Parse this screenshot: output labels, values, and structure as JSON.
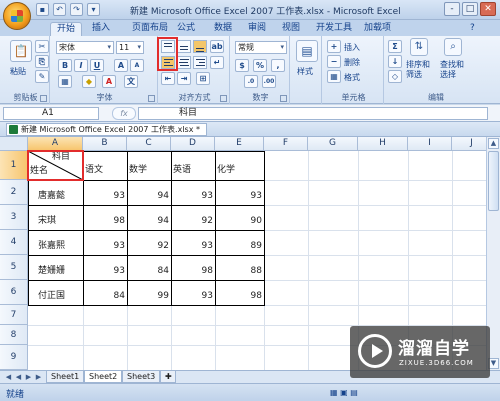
{
  "window": {
    "title": "新建 Microsoft Office Excel 2007 工作表.xlsx - Microsoft Excel",
    "qat_icons": [
      "save-icon",
      "undo-icon",
      "redo-icon",
      "customize-icon"
    ],
    "controls": [
      "-",
      "□",
      "✕"
    ]
  },
  "ribbon_tabs": [
    "开始",
    "插入",
    "页面布局",
    "公式",
    "数据",
    "审阅",
    "视图",
    "开发工具",
    "加载项"
  ],
  "active_tab": "开始",
  "clipboard": {
    "paste_label": "粘贴",
    "group_label": "剪贴板"
  },
  "font_group": {
    "font_name": "宋体",
    "font_size": "11",
    "bold": "B",
    "italic": "I",
    "underline": "U",
    "grow": "A",
    "shrink": "A",
    "wen": "文",
    "group_label": "字体"
  },
  "alignment": {
    "group_label": "对齐方式",
    "highlight_color": "#e22c2c"
  },
  "number": {
    "format": "常规",
    "currency": "$",
    "percent": "%",
    "comma": ",",
    "group_label": "数字"
  },
  "styles": {
    "label": "样式"
  },
  "cells": {
    "insert": "插入",
    "delete": "删除",
    "format": "格式",
    "group_label": "单元格"
  },
  "editing": {
    "sum": "Σ",
    "sort_filter": "排序和\n筛选",
    "find_select": "查找和\n选择",
    "group_label": "编辑"
  },
  "formula_bar": {
    "name_box": "A1",
    "fx": "fx",
    "content": "科目"
  },
  "workbook_tab": "新建 Microsoft Office Excel 2007 工作表.xlsx *",
  "columns": [
    "A",
    "B",
    "C",
    "D",
    "E",
    "F",
    "G",
    "H",
    "I",
    "J"
  ],
  "rows": [
    "1",
    "2",
    "3",
    "4",
    "5",
    "6",
    "7",
    "8",
    "9"
  ],
  "header_cell": {
    "top_right": "科目",
    "bottom_left": "姓名"
  },
  "subject_headers": [
    "语文",
    "数学",
    "英语",
    "化学"
  ],
  "students": [
    {
      "name": "唐嘉懿",
      "scores": [
        "93",
        "94",
        "93",
        "93"
      ]
    },
    {
      "name": "宋琪",
      "scores": [
        "98",
        "94",
        "92",
        "90"
      ]
    },
    {
      "name": "张嘉熙",
      "scores": [
        "93",
        "92",
        "93",
        "89"
      ]
    },
    {
      "name": "楚姗姗",
      "scores": [
        "93",
        "84",
        "98",
        "88"
      ]
    },
    {
      "name": "付正国",
      "scores": [
        "84",
        "99",
        "93",
        "98"
      ]
    }
  ],
  "sheet_tabs": [
    "Sheet1",
    "Sheet2",
    "Sheet3"
  ],
  "active_sheet": "Sheet2",
  "status": {
    "ready": "就绪"
  },
  "watermark": {
    "name": "溜溜自学",
    "url": "ZIXUE.3D66.COM"
  }
}
